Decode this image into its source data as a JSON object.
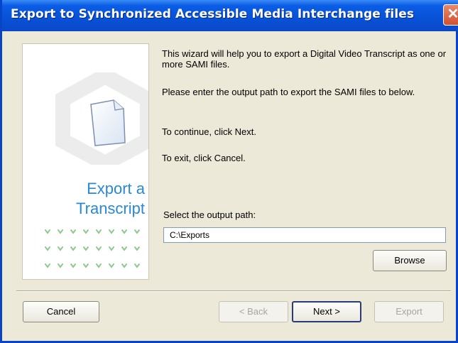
{
  "window": {
    "title": "Export to Synchronized Accessible Media Interchange files",
    "close_glyph": "✕"
  },
  "left_panel": {
    "title_line1": "Export a",
    "title_line2": "Transcript"
  },
  "content": {
    "para1": "This wizard will help you to export a Digital Video Transcript as one or more SAMI files.",
    "para2": "Please enter the output path to export the SAMI files to below.",
    "para3": "To continue, click Next.",
    "para4": "To exit, click Cancel.",
    "path_label": "Select the output path:",
    "path_value": "C:\\Exports"
  },
  "buttons": {
    "browse": "Browse",
    "cancel": "Cancel",
    "back": "< Back",
    "next": "Next >",
    "export": "Export"
  }
}
